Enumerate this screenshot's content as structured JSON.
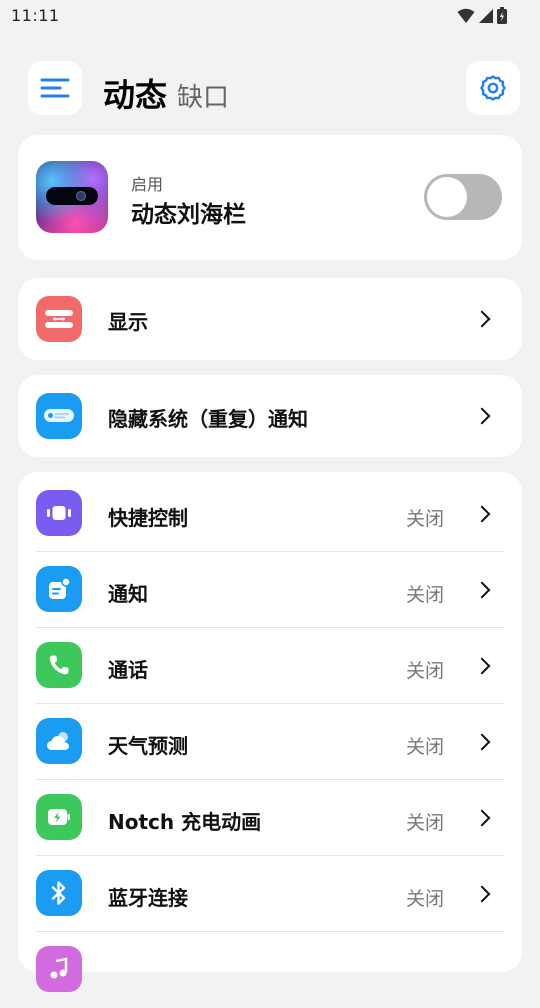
{
  "status_bar": {
    "time": "11:11",
    "icons": [
      "wifi-icon",
      "signal-icon",
      "battery-icon"
    ]
  },
  "header": {
    "title": "动态",
    "subtitle": "缺口",
    "menu_icon": "menu-icon",
    "settings_icon": "gear-icon"
  },
  "enable_card": {
    "caption": "启用",
    "title": "动态刘海栏",
    "toggle_on": false
  },
  "display_item": {
    "label": "显示",
    "icon": "display-icon",
    "color": "#f26b6b"
  },
  "hide_item": {
    "label": "隐藏系统（重复）通知",
    "icon": "notification-banner-icon",
    "color": "#1a9cf2"
  },
  "features": [
    {
      "label": "快捷控制",
      "status": "关闭",
      "icon": "quick-control-icon",
      "color": "#7a5cf0"
    },
    {
      "label": "通知",
      "status": "关闭",
      "icon": "notification-icon",
      "color": "#1a9cf2"
    },
    {
      "label": "通话",
      "status": "关闭",
      "icon": "phone-icon",
      "color": "#3cc85a"
    },
    {
      "label": "天气预测",
      "status": "关闭",
      "icon": "weather-icon",
      "color": "#1a9cf2"
    },
    {
      "label": "Notch 充电动画",
      "status": "关闭",
      "icon": "charging-icon",
      "color": "#3cc85a"
    },
    {
      "label": "蓝牙连接",
      "status": "关闭",
      "icon": "bluetooth-icon",
      "color": "#1a9cf2"
    },
    {
      "label": "",
      "status": "",
      "icon": "music-icon",
      "color": "#d36be0"
    }
  ]
}
